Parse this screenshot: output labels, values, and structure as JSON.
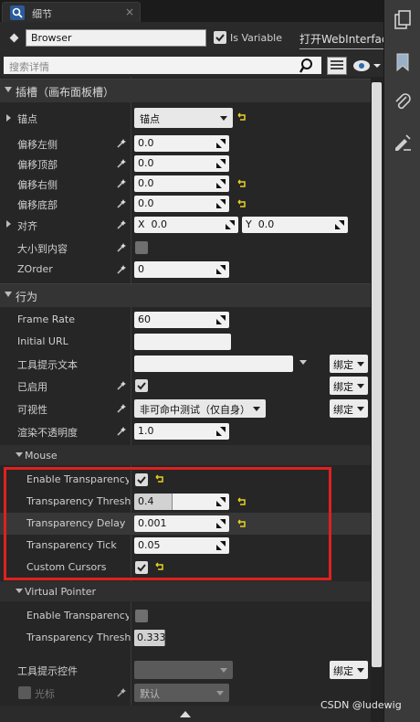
{
  "tab": {
    "title": "细节",
    "close": "×"
  },
  "header": {
    "name_value": "Browser",
    "is_variable_label": "Is Variable",
    "open_link": "打开WebInterface"
  },
  "search": {
    "placeholder": "搜索详情"
  },
  "cat_slot": {
    "label": "插槽（画布面板槽）"
  },
  "anchor": {
    "label": "锚点",
    "value": "锚点"
  },
  "offset_left": {
    "label": "偏移左侧",
    "value": "0.0"
  },
  "offset_top": {
    "label": "偏移顶部",
    "value": "0.0"
  },
  "offset_right": {
    "label": "偏移右侧",
    "value": "0.0"
  },
  "offset_bottom": {
    "label": "偏移底部",
    "value": "0.0"
  },
  "alignment": {
    "label": "对齐",
    "x_label": "X",
    "x_value": "0.0",
    "y_label": "Y",
    "y_value": "0.0"
  },
  "size_to_content": {
    "label": "大小到内容"
  },
  "zorder": {
    "label": "ZOrder",
    "value": "0"
  },
  "cat_behavior": {
    "label": "行为"
  },
  "frame_rate": {
    "label": "Frame Rate",
    "value": "60"
  },
  "initial_url": {
    "label": "Initial URL",
    "value": ""
  },
  "tooltip_text": {
    "label": "工具提示文本",
    "bind": "绑定"
  },
  "enabled": {
    "label": "已启用",
    "bind": "绑定"
  },
  "visibility": {
    "label": "可视性",
    "value": "非可命中测试（仅自身）",
    "bind": "绑定"
  },
  "render_opacity": {
    "label": "渲染不透明度",
    "value": "1.0"
  },
  "mouse": {
    "label": "Mouse",
    "enable_transparency": {
      "label": "Enable Transparency"
    },
    "transparency_threshold": {
      "label": "Transparency Threshold",
      "value": "0.4",
      "fill": 0.4
    },
    "transparency_delay": {
      "label": "Transparency Delay",
      "value": "0.001"
    },
    "transparency_tick": {
      "label": "Transparency Tick",
      "value": "0.05"
    },
    "custom_cursors": {
      "label": "Custom Cursors"
    }
  },
  "virtual_pointer": {
    "label": "Virtual Pointer",
    "enable_transparency": {
      "label": "Enable Transparency"
    },
    "transparency_threshold": {
      "label": "Transparency Threshold",
      "value": "0.333",
      "fill": 0.333
    }
  },
  "tooltip_widget": {
    "label": "工具提示控件",
    "bind": "绑定"
  },
  "cursor": {
    "label": "光标",
    "value": "默认"
  },
  "watermark": "CSDN @ludewig"
}
